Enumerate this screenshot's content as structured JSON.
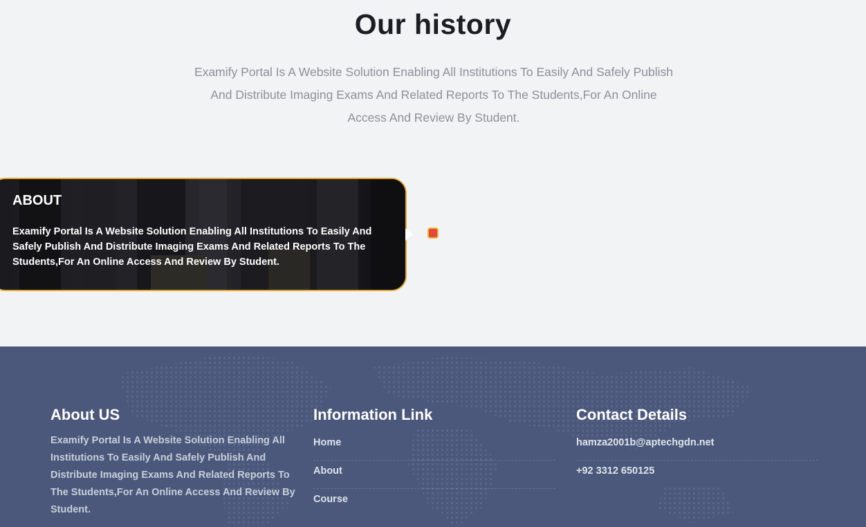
{
  "history": {
    "title": "Our history",
    "lead": "Examify Portal Is A Website Solution Enabling All Institutions To Easily And Safely Publish And Distribute Imaging Exams And Related Reports To The Students,For An Online Access And Review By Student."
  },
  "timeline": {
    "card_title": "ABOUT",
    "card_text": "Examify Portal Is A Website Solution Enabling All Institutions To Easily And Safely Publish And Distribute Imaging Exams And Related Reports To The Students,For An Online Access And Review By Student."
  },
  "footer": {
    "about": {
      "title": "About US",
      "text": "Examify Portal Is A Website Solution Enabling All Institutions To Easily And Safely Publish And Distribute Imaging Exams And Related Reports To The Students,For An Online Access And Review By Student."
    },
    "info": {
      "title": "Information Link",
      "links": [
        "Home",
        "About",
        "Course"
      ]
    },
    "contact": {
      "title": "Contact Details",
      "email": "hamza2001b@aptechgdn.net",
      "phone": "+92 3312 650125"
    }
  },
  "colors": {
    "page_bg": "#f2f3f5",
    "footer_bg": "#4b587b",
    "accent_border": "#e3a72f",
    "marker": "#e04a3c"
  }
}
